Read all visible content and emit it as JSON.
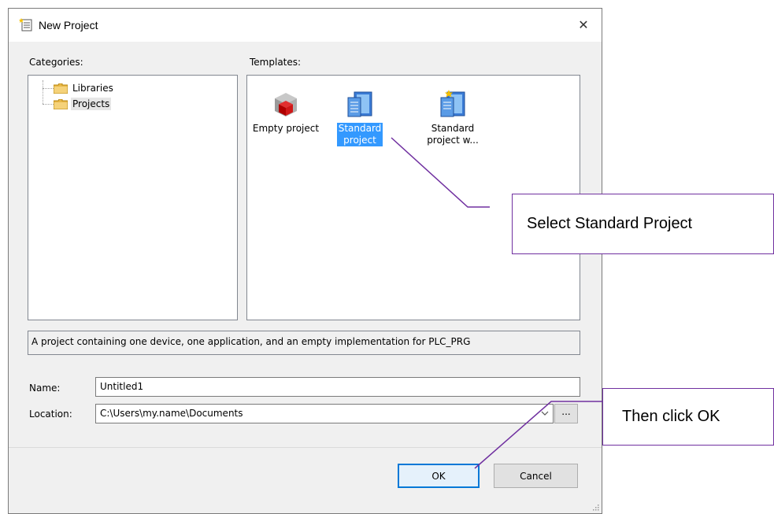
{
  "dialog": {
    "title": "New Project",
    "close_symbol": "✕"
  },
  "categories": {
    "label": "Categories:",
    "items": [
      {
        "label": "Libraries",
        "icon": "folder-icon"
      },
      {
        "label": "Projects",
        "icon": "folder-icon",
        "selected": true
      }
    ]
  },
  "templates": {
    "label": "Templates:",
    "items": [
      {
        "label_lines": [
          "Empty project"
        ],
        "icon": "empty-project-icon"
      },
      {
        "label_lines": [
          "Standard",
          "project"
        ],
        "icon": "standard-project-icon",
        "selected": true
      },
      {
        "label_lines": [
          "Standard",
          "project w..."
        ],
        "icon": "standard-project-wizard-icon"
      }
    ]
  },
  "description": "A project containing one device, one application, and an empty implementation for PLC_PRG",
  "form": {
    "name_label": "Name:",
    "name_value": "Untitled1",
    "location_label": "Location:",
    "location_value": "C:\\Users\\my.name\\Documents",
    "browse_label": "..."
  },
  "buttons": {
    "ok_label": "OK",
    "cancel_label": "Cancel"
  },
  "annotations": {
    "callout1": "Select Standard Project",
    "callout2": "Then click OK",
    "line_color": "#7030a0"
  },
  "colors": {
    "selection": "#3399ff",
    "default_button_border": "#0078d7"
  }
}
